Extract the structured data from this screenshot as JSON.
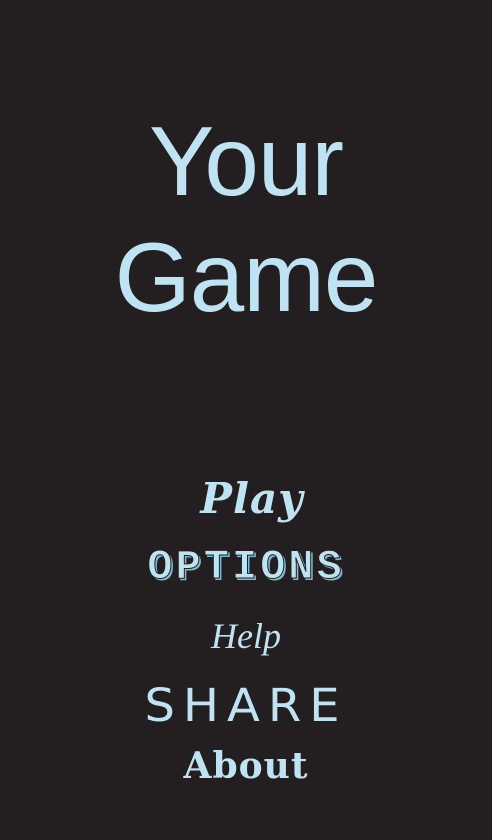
{
  "game": {
    "title_line1": "Your",
    "title_line2": "Game"
  },
  "menu": {
    "play": "Play",
    "options": "OPTIONS",
    "help": "Help",
    "share": "SHARE",
    "about": "About"
  },
  "colors": {
    "background": "#231f20",
    "text": "#bfe3f2"
  }
}
